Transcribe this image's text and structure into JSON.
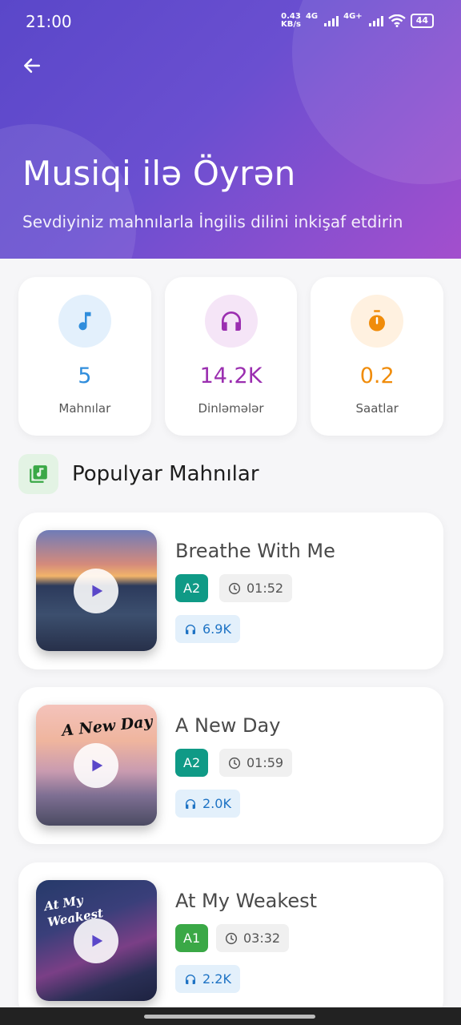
{
  "status_bar": {
    "time": "21:00",
    "speed_value": "0.43",
    "speed_unit": "KB/s",
    "net1": "4G",
    "net2": "4G+",
    "battery": "44"
  },
  "header": {
    "title": "Musiqi ilə Öyrən",
    "subtitle": "Sevdiyiniz mahnılarla İngilis dilini inkişaf etdirin"
  },
  "stats": [
    {
      "value": "5",
      "label": "Mahnılar",
      "icon": "music-note-icon",
      "color": "#2f8ddc",
      "bg": "#e3f0fc"
    },
    {
      "value": "14.2K",
      "label": "Dinləmələr",
      "icon": "headphones-icon",
      "color": "#9b2fb0",
      "bg": "#f5e5f7"
    },
    {
      "value": "0.2",
      "label": "Saatlar",
      "icon": "timer-icon",
      "color": "#f08c0a",
      "bg": "#fff1e0"
    }
  ],
  "section": {
    "title": "Populyar Mahnılar",
    "icon": "library-music-icon"
  },
  "songs": [
    {
      "title": "Breathe With Me",
      "level": "A2",
      "level_color": "#0f9a86",
      "duration": "01:52",
      "plays": "6.9K"
    },
    {
      "title": "A New Day",
      "level": "A2",
      "level_color": "#0f9a86",
      "duration": "01:59",
      "plays": "2.0K",
      "cover_text": "A New Day"
    },
    {
      "title": "At My Weakest",
      "level": "A1",
      "level_color": "#3aa846",
      "duration": "03:32",
      "plays": "2.2K",
      "cover_text_1": "At My",
      "cover_text_2": "Weakest"
    }
  ]
}
